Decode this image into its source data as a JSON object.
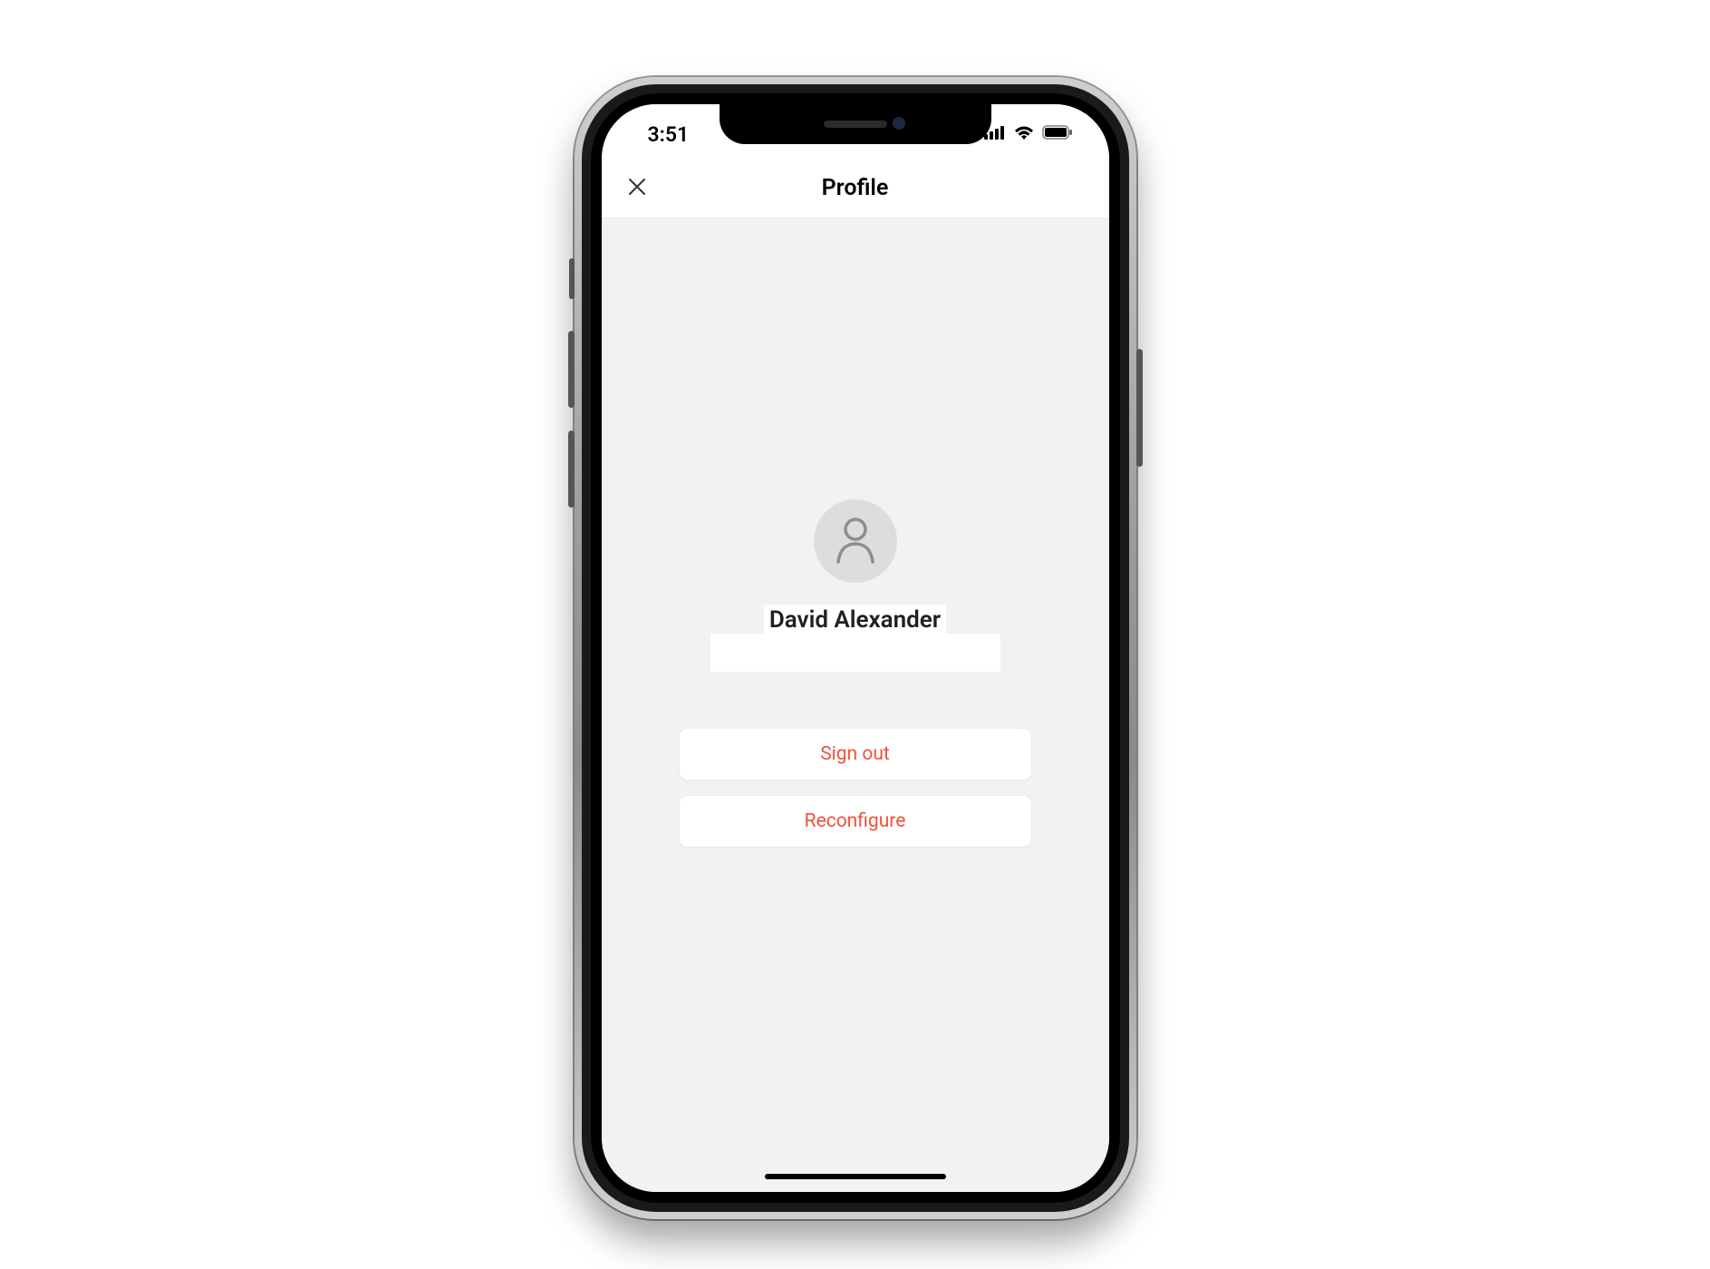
{
  "status_bar": {
    "time": "3:51"
  },
  "nav": {
    "title": "Profile"
  },
  "profile": {
    "name": "David Alexander"
  },
  "actions": {
    "sign_out": "Sign out",
    "reconfigure": "Reconfigure"
  },
  "colors": {
    "accent": "#f0513c",
    "screen_bg": "#f2f2f2",
    "avatar_bg": "#dddddd"
  }
}
